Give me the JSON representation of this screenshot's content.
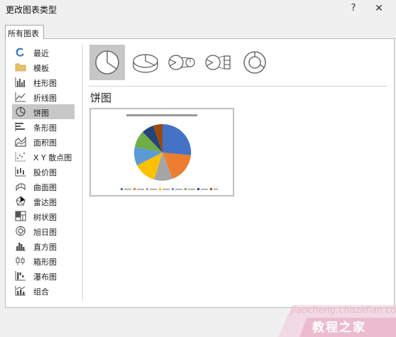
{
  "dialog": {
    "title": "更改图表类型",
    "help": "?",
    "close": "✕"
  },
  "tab": {
    "label": "所有图表"
  },
  "sidebar": {
    "items": [
      {
        "label": "最近",
        "icon": "recent-icon"
      },
      {
        "label": "模板",
        "icon": "folder-icon"
      },
      {
        "label": "柱形图",
        "icon": "column-chart-icon"
      },
      {
        "label": "折线图",
        "icon": "line-chart-icon"
      },
      {
        "label": "饼图",
        "icon": "pie-chart-icon"
      },
      {
        "label": "条形图",
        "icon": "bar-chart-icon"
      },
      {
        "label": "面积图",
        "icon": "area-chart-icon"
      },
      {
        "label": "X Y 散点图",
        "icon": "scatter-chart-icon"
      },
      {
        "label": "股价图",
        "icon": "stock-chart-icon"
      },
      {
        "label": "曲面图",
        "icon": "surface-chart-icon"
      },
      {
        "label": "雷达图",
        "icon": "radar-chart-icon"
      },
      {
        "label": "树状图",
        "icon": "treemap-chart-icon"
      },
      {
        "label": "旭日图",
        "icon": "sunburst-chart-icon"
      },
      {
        "label": "直方图",
        "icon": "histogram-chart-icon"
      },
      {
        "label": "箱形图",
        "icon": "box-whisker-chart-icon"
      },
      {
        "label": "瀑布图",
        "icon": "waterfall-chart-icon"
      },
      {
        "label": "组合",
        "icon": "combo-chart-icon"
      }
    ],
    "selected": "饼图"
  },
  "subtypes": [
    "pie-icon",
    "3d-pie-icon",
    "pie-of-pie-icon",
    "bar-of-pie-icon",
    "doughnut-icon"
  ],
  "section": {
    "title": "饼图"
  },
  "colors": {
    "selected_bg": "#c7c7c7",
    "accent_blue": "#2e75b6",
    "pie_slices": [
      "#4472c4",
      "#ed7d31",
      "#a5a5a5",
      "#ffc000",
      "#5b9bd5",
      "#70ad47",
      "#264478",
      "#9e480e"
    ]
  },
  "watermark": {
    "url": "jiaocheng.chazidian.com",
    "cn": "教程之家"
  }
}
